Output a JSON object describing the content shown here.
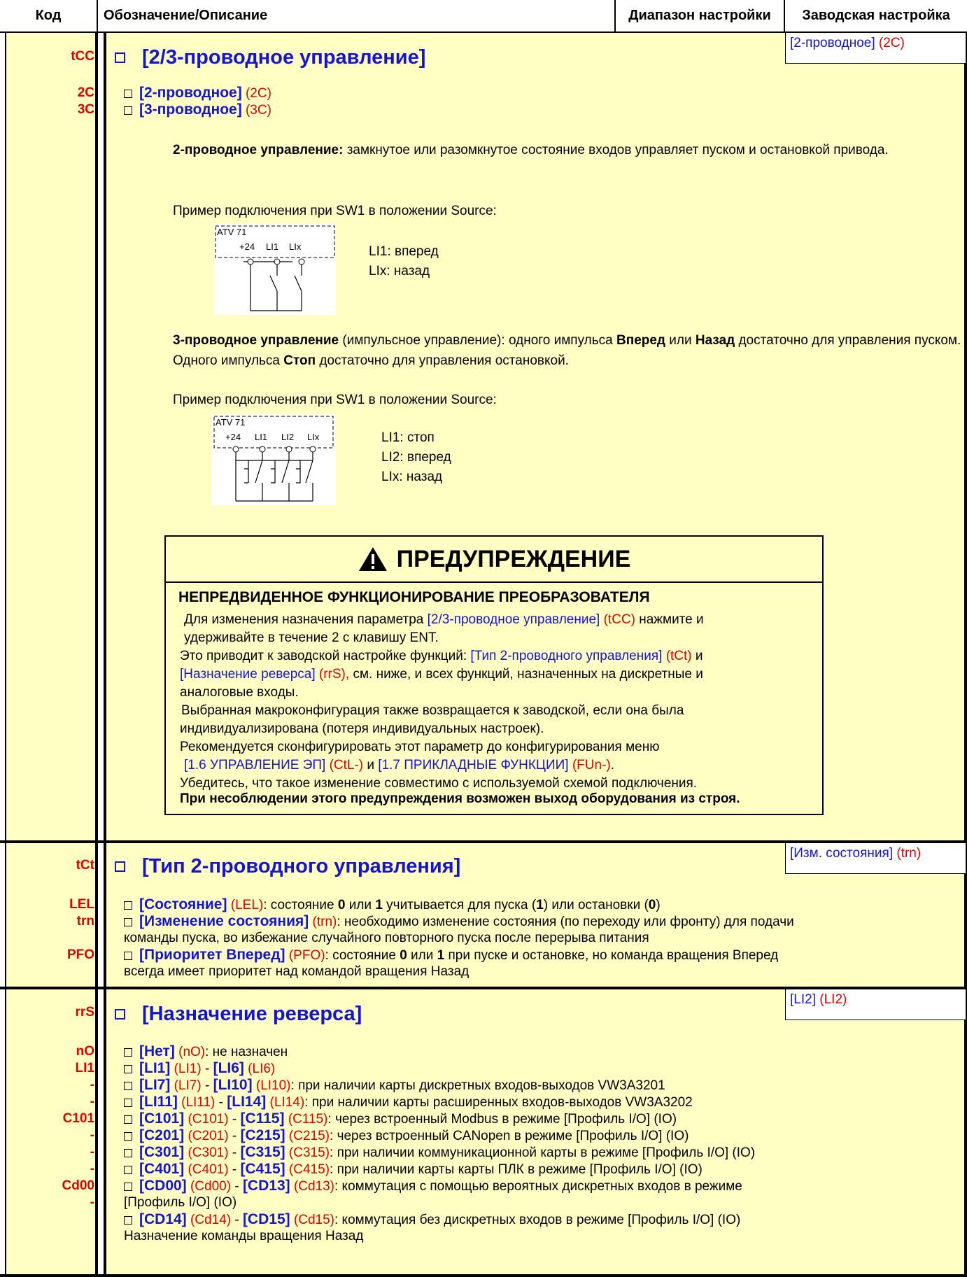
{
  "header": {
    "col_code": "Код",
    "col_desc": "Обозначение/Описание",
    "col_range": "Диапазон настройки",
    "col_factory": "Заводская настройка"
  },
  "sec1": {
    "code": "tCC",
    "codes": [
      "2C",
      "3C"
    ],
    "title": "[2/3-проводное управление]",
    "factory": "[2-проводное]",
    "factory_code": "(2C)",
    "options": [
      {
        "label": "[2-проводное]",
        "code": "(2C)"
      },
      {
        "label": "[3-проводное]",
        "code": "(3C)"
      }
    ],
    "p1_bold": "2-проводное управление:",
    "p1_rest": " замкнутое или разомкнутое состояние входов управляет пуском и остановкой привода.",
    "example1": "Пример подключения при SW1 в положении Source:",
    "d1": {
      "atv": "ATV 71",
      "t1": "+24",
      "t2": "LI1",
      "t3": "LIx"
    },
    "d1_notes": [
      "LI1: вперед",
      "LIx: назад"
    ],
    "p2_a": "3-проводное управление",
    "p2_b": " (импульсное управление): одного импульса ",
    "p2_c": "Вперед",
    "p2_d": " или ",
    "p2_e": "Назад",
    "p2_f": " достаточно для управления пуском. Одного импульса ",
    "p2_g": "Стоп",
    "p2_h": " достаточно для управления остановкой.",
    "example2": "Пример подключения при SW1 в положении Source:",
    "d2": {
      "atv": "ATV 71",
      "t1": "+24",
      "t2": "LI1",
      "t3": "LI2",
      "t4": "LIx"
    },
    "d2_notes": [
      "LI1: стоп",
      "LI2: вперед",
      "LIx: назад"
    ]
  },
  "warning": {
    "title": "ПРЕДУПРЕЖДЕНИЕ",
    "subtitle": "НЕПРЕДВИДЕННОЕ ФУНКЦИОНИРОВАНИЕ ПРЕОБРАЗОВАТЕЛЯ",
    "l1a": "Для изменения назначения параметра ",
    "l1b": "[2/3-проводное управление]",
    "l1c": " (tCC)",
    "l1d": " нажмите и",
    "l2": "удерживайте в течение 2 с клавишу ENT.",
    "l3a": "Это приводит к заводской настройке функций: ",
    "l3b": "[Тип 2-проводного управления]",
    "l3c": " (tCt)",
    "l3d": " и",
    "l4a": "[Назначение реверса]",
    "l4b": " (rrS),",
    "l4c": " см. ниже, и  всех функций, назначенных на дискретные и",
    "l5": "аналоговые входы.",
    "l6": "Выбранная макроконфигурация также возвращается к заводской, если она была",
    "l7": "индивидуализирована (потеря индивидуальных настроек).",
    "l8": "Рекомендуется сконфигурировать этот параметр до конфигурирования меню",
    "l9a": "[1.6 УПРАВЛЕНИЕ ЭП]",
    "l9b": " (CtL-)",
    "l9c": " и ",
    "l9d": "[1.7 ПРИКЛАДНЫЕ ФУНКЦИИ]",
    "l9e": " (FUn-)",
    "l9f": ".",
    "l10": "Убедитесь, что такое изменение совместимо с используемой схемой подключения.",
    "l11": "При несоблюдении этого предупреждения возможен выход оборудования из строя."
  },
  "sec2": {
    "code": "tCt",
    "codes": [
      "LEL",
      "trn",
      "PFO"
    ],
    "title": "[Тип 2-проводного управления]",
    "factory": "[Изм. состояния]",
    "factory_code": "(trn)",
    "o1a": "[Состояние]",
    "o1b": " (LEL)",
    "o1c": ": состояние ",
    "o1d": "0",
    "o1e": " или ",
    "o1f": "1",
    "o1g": " учитывается для пуска (",
    "o1h": "1",
    "o1i": ") или остановки (",
    "o1j": "0",
    "o1k": ")",
    "o2a": "[Изменение состояния]",
    "o2b": " (trn)",
    "o2c": ": необходимо изменение состояния (по переходу или фронту) для подачи",
    "o2d": "команды пуска, во избежание случайного повторного пуска после перерыва питания",
    "o3a": "[Приоритет Вперед]",
    "o3b": " (PFO)",
    "o3c": ": состояние ",
    "o3d": "0",
    "o3e": " или ",
    "o3f": "1",
    "o3g": " при пуске и остановке, но команда вращения Вперед",
    "o3h": "всегда имеет приоритет над командой вращения Назад"
  },
  "sec3": {
    "code": "rrS",
    "codes": [
      "nO",
      "LI1",
      "-",
      "-",
      "C101",
      "-",
      "-",
      "-",
      "Cd00",
      "-"
    ],
    "title": "[Назначение реверса]",
    "factory": "[LI2]",
    "factory_code": "(LI2)",
    "opts": [
      {
        "a": "[Нет]",
        "b": " (nO)",
        "c": ": не назначен"
      },
      {
        "a": "[LI1]",
        "b": " (LI1)",
        "c": " - ",
        "d": "[LI6]",
        "e": " (LI6)",
        "f": ""
      },
      {
        "a": "[LI7]",
        "b": " (LI7)",
        "c": " - ",
        "d": "[LI10]",
        "e": " (LI10)",
        "f": ": при наличии карты дискретных входов-выходов VW3A3201"
      },
      {
        "a": "[LI11]",
        "b": " (LI11)",
        "c": " - ",
        "d": "[LI14]",
        "e": " (LI14)",
        "f": ": при наличии карты расширенных входов-выходов VW3A3202"
      },
      {
        "a": "[C101]",
        "b": " (C101)",
        "c": " - ",
        "d": "[C115]",
        "e": " (C115)",
        "f": ": через встроенный Modbus в режиме [Профиль I/O] (IO)"
      },
      {
        "a": "[C201]",
        "b": " (C201)",
        "c": " - ",
        "d": "[C215]",
        "e": " (C215)",
        "f": ": через встроенный CANopen в режиме [Профиль I/O] (IO)"
      },
      {
        "a": "[C301]",
        "b": " (C301)",
        "c": " - ",
        "d": "[C315]",
        "e": " (C315)",
        "f": ": при наличии коммуникационной карты в режиме [Профиль I/O] (IO)"
      },
      {
        "a": "[C401]",
        "b": " (C401)",
        "c": " - ",
        "d": "[C415]",
        "e": " (C415)",
        "f": ": при наличии карты карты ПЛК в режиме [Профиль I/O] (IO)"
      },
      {
        "a": "[CD00]",
        "b": " (Cd00)",
        "c": " - ",
        "d": "[CD13]",
        "e": " (Cd13)",
        "f": ": коммутация с помощью вероятных дискретных входов в режиме"
      },
      {
        "a": "",
        "b": "",
        "c": "",
        "d": "",
        "e": "",
        "f": "[Профиль I/O] (IO)"
      },
      {
        "a": "[CD14]",
        "b": " (Cd14)",
        "c": " - ",
        "d": "[CD15]",
        "e": " (Cd15)",
        "f": ": коммутация без дискретных входов в режиме [Профиль I/O] (IO)"
      },
      {
        "a": "",
        "b": "",
        "c": "",
        "d": "",
        "e": "",
        "f": "Назначение команды вращения Назад"
      }
    ]
  }
}
